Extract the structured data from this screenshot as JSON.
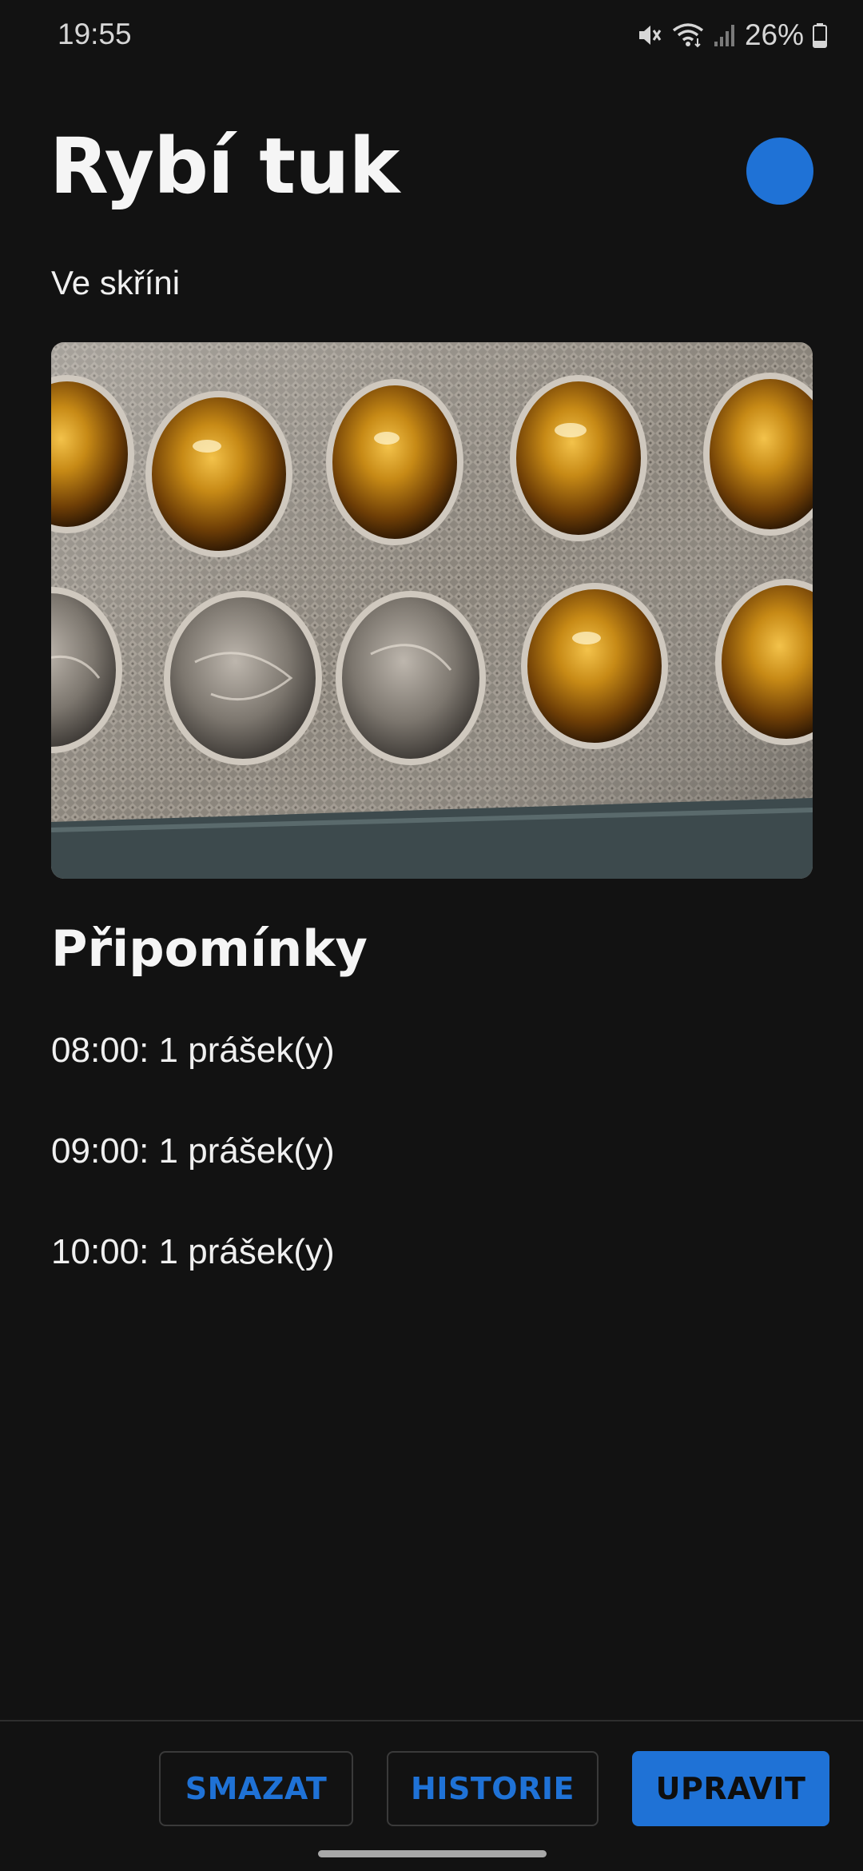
{
  "status_bar": {
    "time": "19:55",
    "battery": "26%",
    "icons": [
      "mute-icon",
      "wifi-icon",
      "signal-icon",
      "battery-icon"
    ]
  },
  "medicine": {
    "name": "Rybí tuk",
    "location": "Ve skříni",
    "color": "#1f72d6",
    "photo": "fish-oil-blister-pack"
  },
  "reminders": {
    "title": "Připomínky",
    "items": [
      "08:00: 1 prášek(y)",
      "09:00: 1 prášek(y)",
      "10:00: 1 prášek(y)"
    ]
  },
  "actions": {
    "delete": "SMAZAT",
    "history": "HISTORIE",
    "edit": "UPRAVIT"
  }
}
